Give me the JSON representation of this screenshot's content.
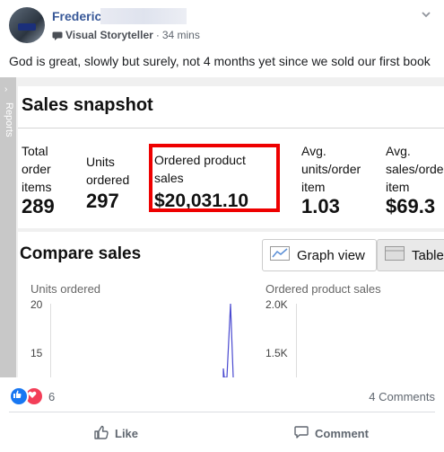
{
  "post": {
    "author": "Frederic",
    "badge": "Visual Storyteller",
    "separator": "·",
    "time": "34 mins",
    "text": "God is great, slowly but surely, not 4 months yet since we sold our first book"
  },
  "screenshot": {
    "reports_tab": "Reports",
    "snapshot_title": "Sales snapshot",
    "metrics": [
      {
        "label_lines": [
          "Total",
          "order",
          "items"
        ],
        "value": "289"
      },
      {
        "label_lines": [
          "Units",
          "ordered"
        ],
        "value": "297"
      },
      {
        "label_lines": [
          "Ordered product",
          "sales"
        ],
        "value": "$20,031.10"
      },
      {
        "label_lines": [
          "Avg.",
          "units/order",
          "item"
        ],
        "value": "1.03"
      },
      {
        "label_lines": [
          "Avg.",
          "sales/orde",
          "item"
        ],
        "value": "$69.3"
      }
    ],
    "compare_title": "Compare sales",
    "graph_view_label": "Graph view",
    "table_view_label": "Table",
    "left_chart": {
      "label": "Units ordered",
      "ticks": [
        "20",
        "15"
      ]
    },
    "right_chart": {
      "label": "Ordered product sales",
      "ticks": [
        "2.0K",
        "1.5K"
      ]
    }
  },
  "footer": {
    "reaction_count": "6",
    "comments": "4 Comments",
    "like_label": "Like",
    "comment_label": "Comment"
  },
  "colors": {
    "author": "#385898",
    "highlight_box": "#ee0000",
    "like_blue": "#1877f2",
    "love_red": "#f33e58",
    "spike": "#4a4ad0"
  }
}
